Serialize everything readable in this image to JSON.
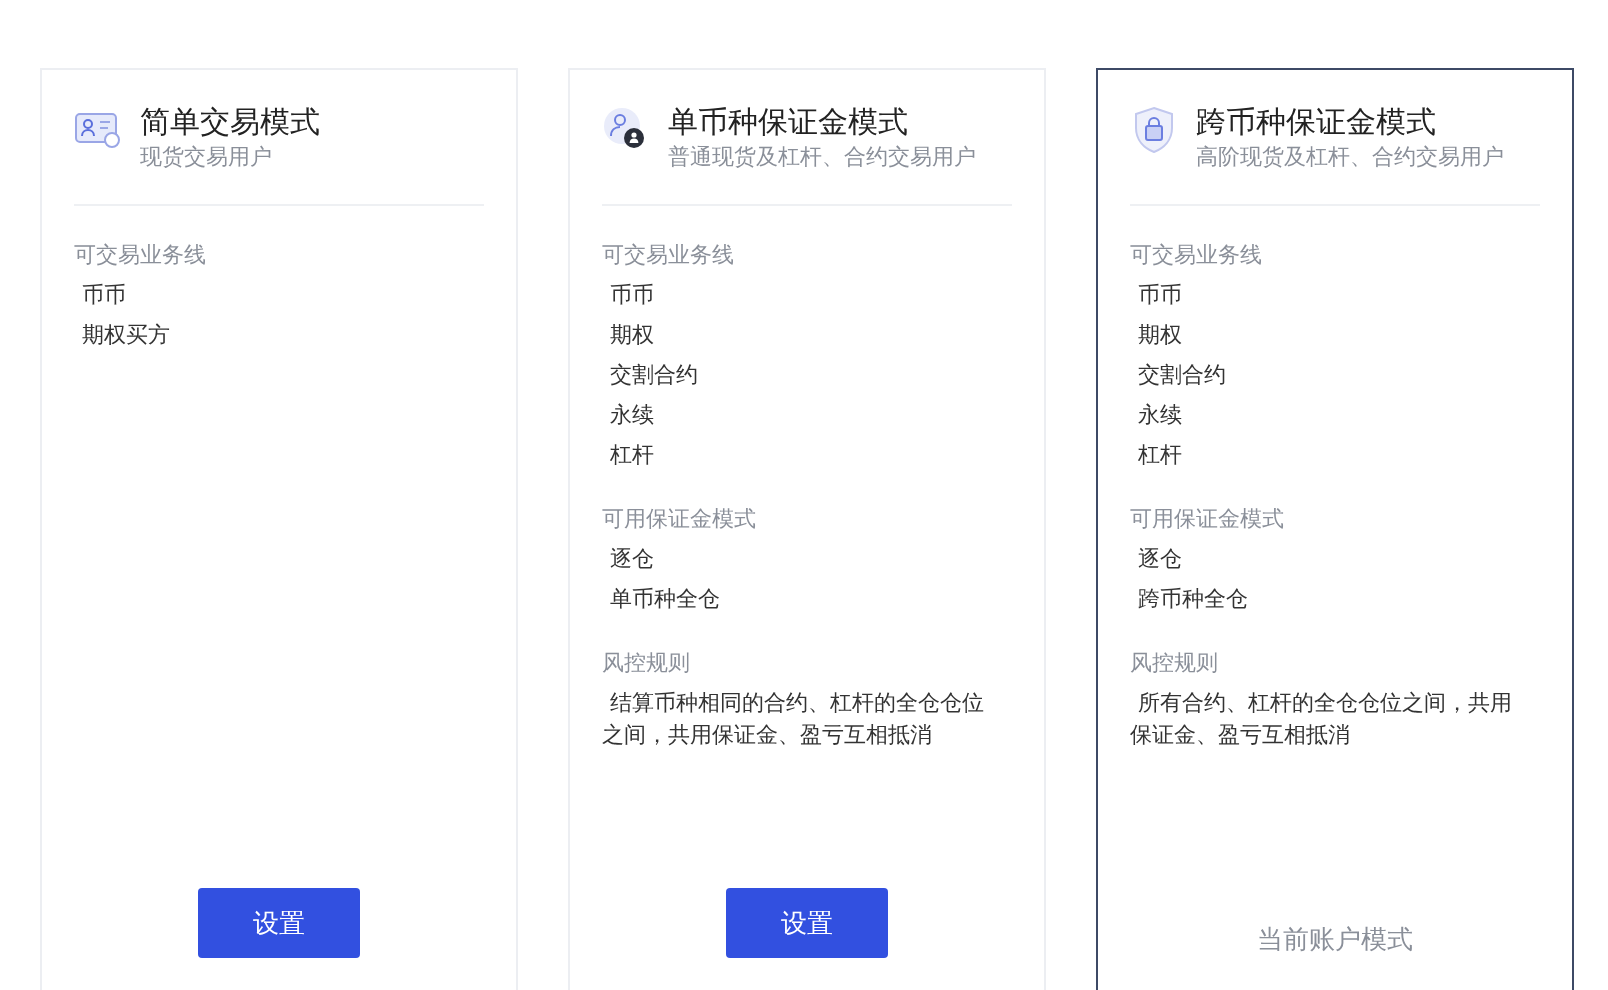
{
  "cards": [
    {
      "title": "简单交易模式",
      "subtitle": "现货交易用户",
      "selected": false,
      "sections": [
        {
          "kind": "list",
          "label": "可交易业务线",
          "items": [
            "币币",
            "期权买方"
          ]
        }
      ],
      "action": {
        "kind": "button",
        "label": "设置"
      }
    },
    {
      "title": "单币种保证金模式",
      "subtitle": "普通现货及杠杆、合约交易用户",
      "selected": false,
      "sections": [
        {
          "kind": "list",
          "label": "可交易业务线",
          "items": [
            "币币",
            "期权",
            "交割合约",
            "永续",
            "杠杆"
          ]
        },
        {
          "kind": "list",
          "label": "可用保证金模式",
          "items": [
            "逐仓",
            "单币种全仓"
          ]
        },
        {
          "kind": "text",
          "label": "风控规则",
          "text": "结算币种相同的合约、杠杆的全仓仓位之间，共用保证金、盈亏互相抵消"
        }
      ],
      "action": {
        "kind": "button",
        "label": "设置"
      }
    },
    {
      "title": "跨币种保证金模式",
      "subtitle": "高阶现货及杠杆、合约交易用户",
      "selected": true,
      "sections": [
        {
          "kind": "list",
          "label": "可交易业务线",
          "items": [
            "币币",
            "期权",
            "交割合约",
            "永续",
            "杠杆"
          ]
        },
        {
          "kind": "list",
          "label": "可用保证金模式",
          "items": [
            "逐仓",
            "跨币种全仓"
          ]
        },
        {
          "kind": "text",
          "label": "风控规则",
          "text": "所有合约、杠杆的全仓仓位之间，共用保证金、盈亏互相抵消"
        }
      ],
      "action": {
        "kind": "current",
        "label": "当前账户模式"
      }
    }
  ]
}
